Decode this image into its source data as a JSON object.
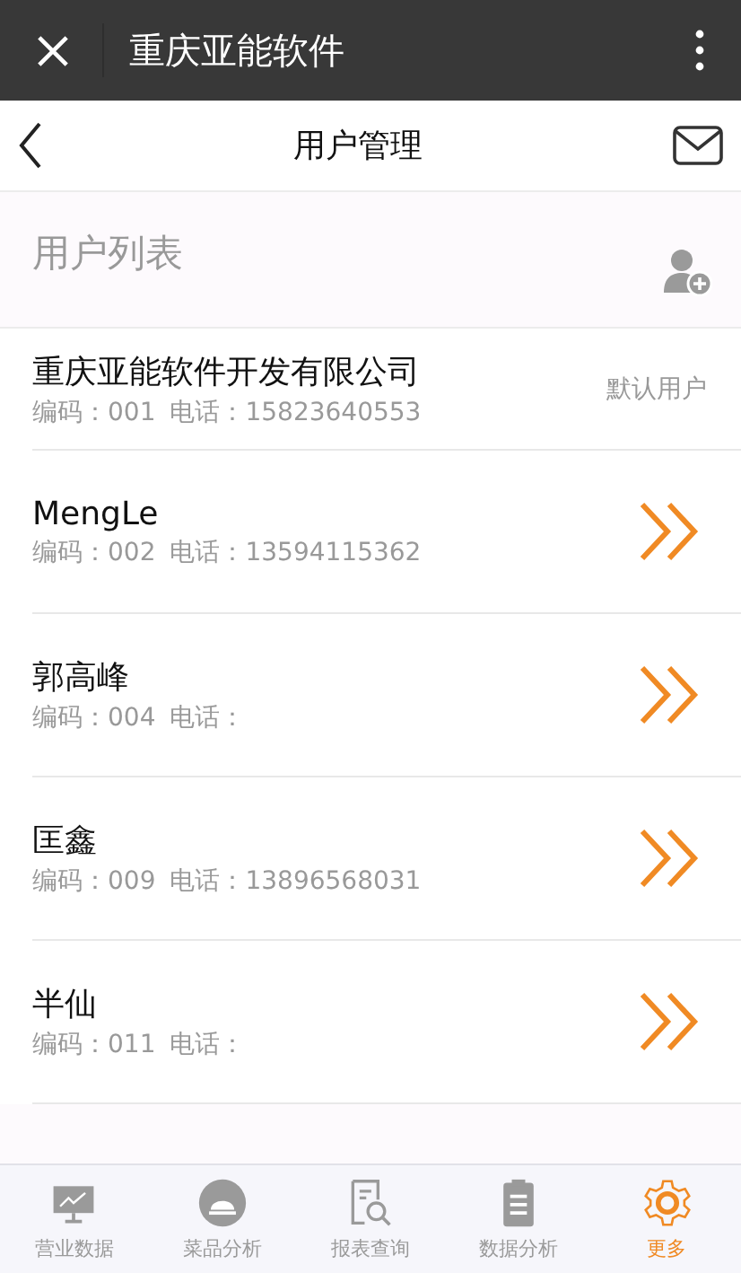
{
  "window": {
    "title": "重庆亚能软件"
  },
  "header": {
    "title": "用户管理"
  },
  "section": {
    "title": "用户列表"
  },
  "users": [
    {
      "name": "重庆亚能软件开发有限公司",
      "code": "编码：001",
      "phone": "电话：15823640553",
      "kind": "default",
      "tag": "默认用户"
    },
    {
      "name": "MengLe",
      "code": "编码：002",
      "phone": "电话：13594115362",
      "kind": "link"
    },
    {
      "name": "郭高峰",
      "code": "编码：004",
      "phone": "电话：",
      "kind": "link"
    },
    {
      "name": "匡鑫",
      "code": "编码：009",
      "phone": "电话：13896568031",
      "kind": "link"
    },
    {
      "name": "半仙",
      "code": "编码：011",
      "phone": "电话：",
      "kind": "link"
    }
  ],
  "tabs": [
    {
      "label": "营业数据",
      "selected": false
    },
    {
      "label": "菜品分析",
      "selected": false
    },
    {
      "label": "报表查询",
      "selected": false
    },
    {
      "label": "数据分析",
      "selected": false
    },
    {
      "label": "更多",
      "selected": true
    }
  ]
}
